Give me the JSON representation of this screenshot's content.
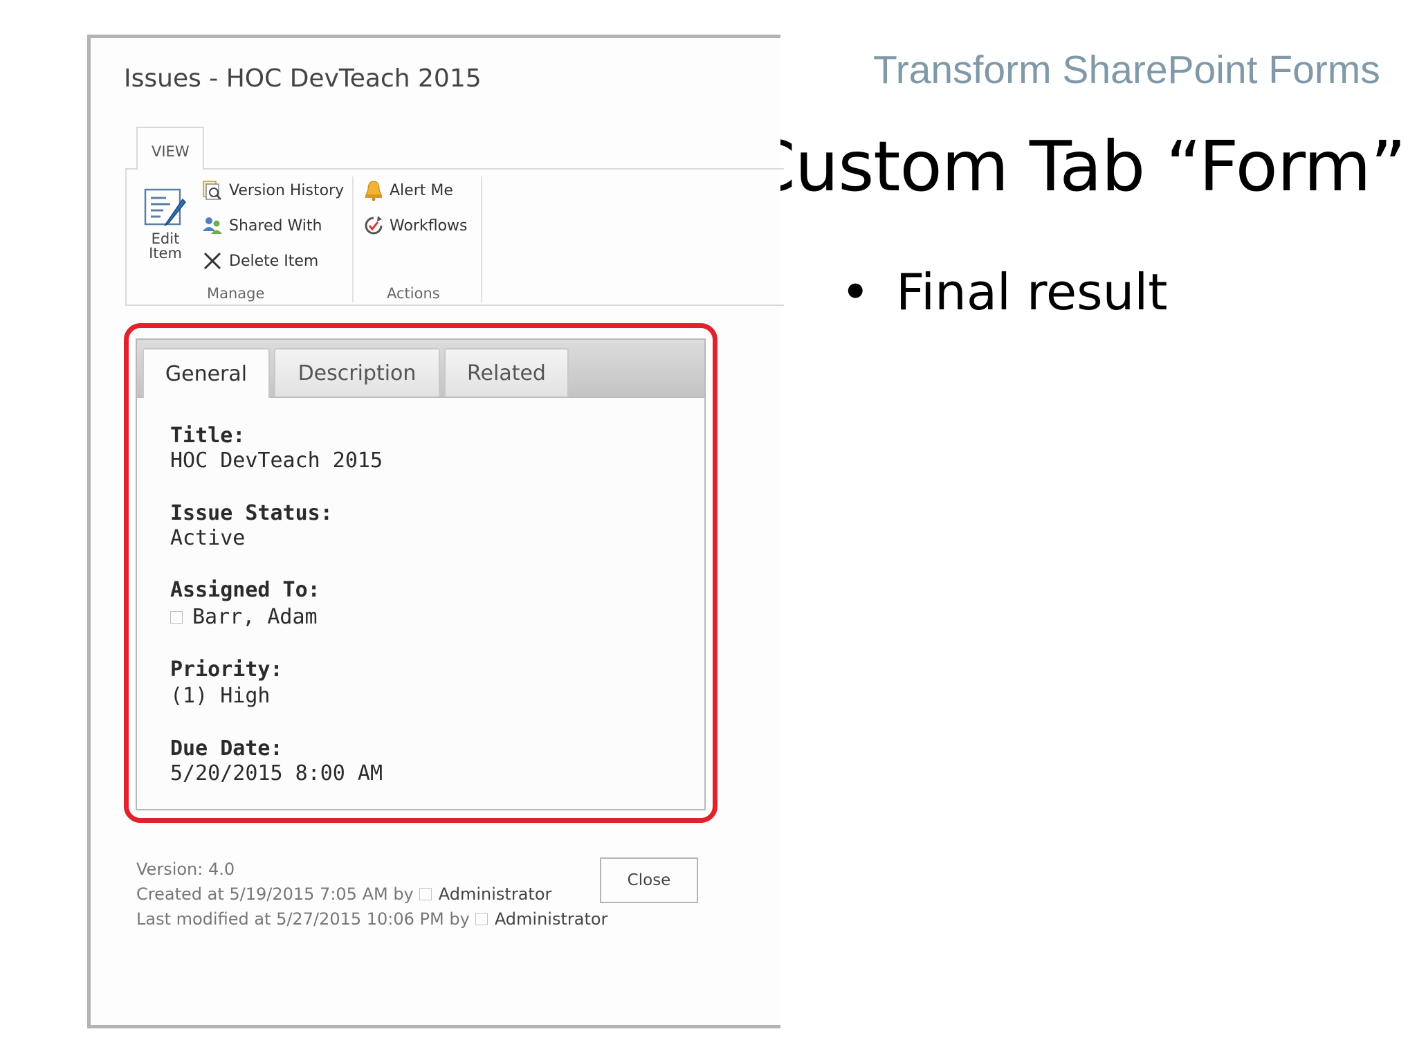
{
  "slide": {
    "tag": "Transform SharePoint Forms",
    "title": "Custom Tab “Form”",
    "bullet": "Final result"
  },
  "dialog": {
    "title": "Issues - HOC DevTeach 2015",
    "ribbon": {
      "tab_label": "VIEW",
      "edit_item_label_line1": "Edit",
      "edit_item_label_line2": "Item",
      "manage": {
        "group_label": "Manage",
        "version_history": "Version History",
        "shared_with": "Shared With",
        "delete_item": "Delete Item"
      },
      "actions": {
        "group_label": "Actions",
        "alert_me": "Alert Me",
        "workflows": "Workflows"
      }
    },
    "form": {
      "tabs": [
        {
          "label": "General",
          "active": true
        },
        {
          "label": "Description",
          "active": false
        },
        {
          "label": "Related",
          "active": false
        }
      ],
      "fields": [
        {
          "label": "Title:",
          "value": "HOC DevTeach 2015"
        },
        {
          "label": "Issue Status:",
          "value": "Active"
        },
        {
          "label": "Assigned To:",
          "value": "Barr, Adam"
        },
        {
          "label": "Priority:",
          "value": "(1) High"
        },
        {
          "label": "Due Date:",
          "value": "5/20/2015 8:00 AM"
        }
      ]
    },
    "footer": {
      "version": "Version: 4.0",
      "created_prefix": "Created at 5/19/2015 7:05 AM  by",
      "created_by": "Administrator",
      "modified_prefix": "Last modified at 5/27/2015 10:06 PM  by",
      "modified_by": "Administrator",
      "close_label": "Close"
    },
    "colors": {
      "highlight": "#e1212b",
      "slide_tag": "#7f99a8"
    }
  }
}
